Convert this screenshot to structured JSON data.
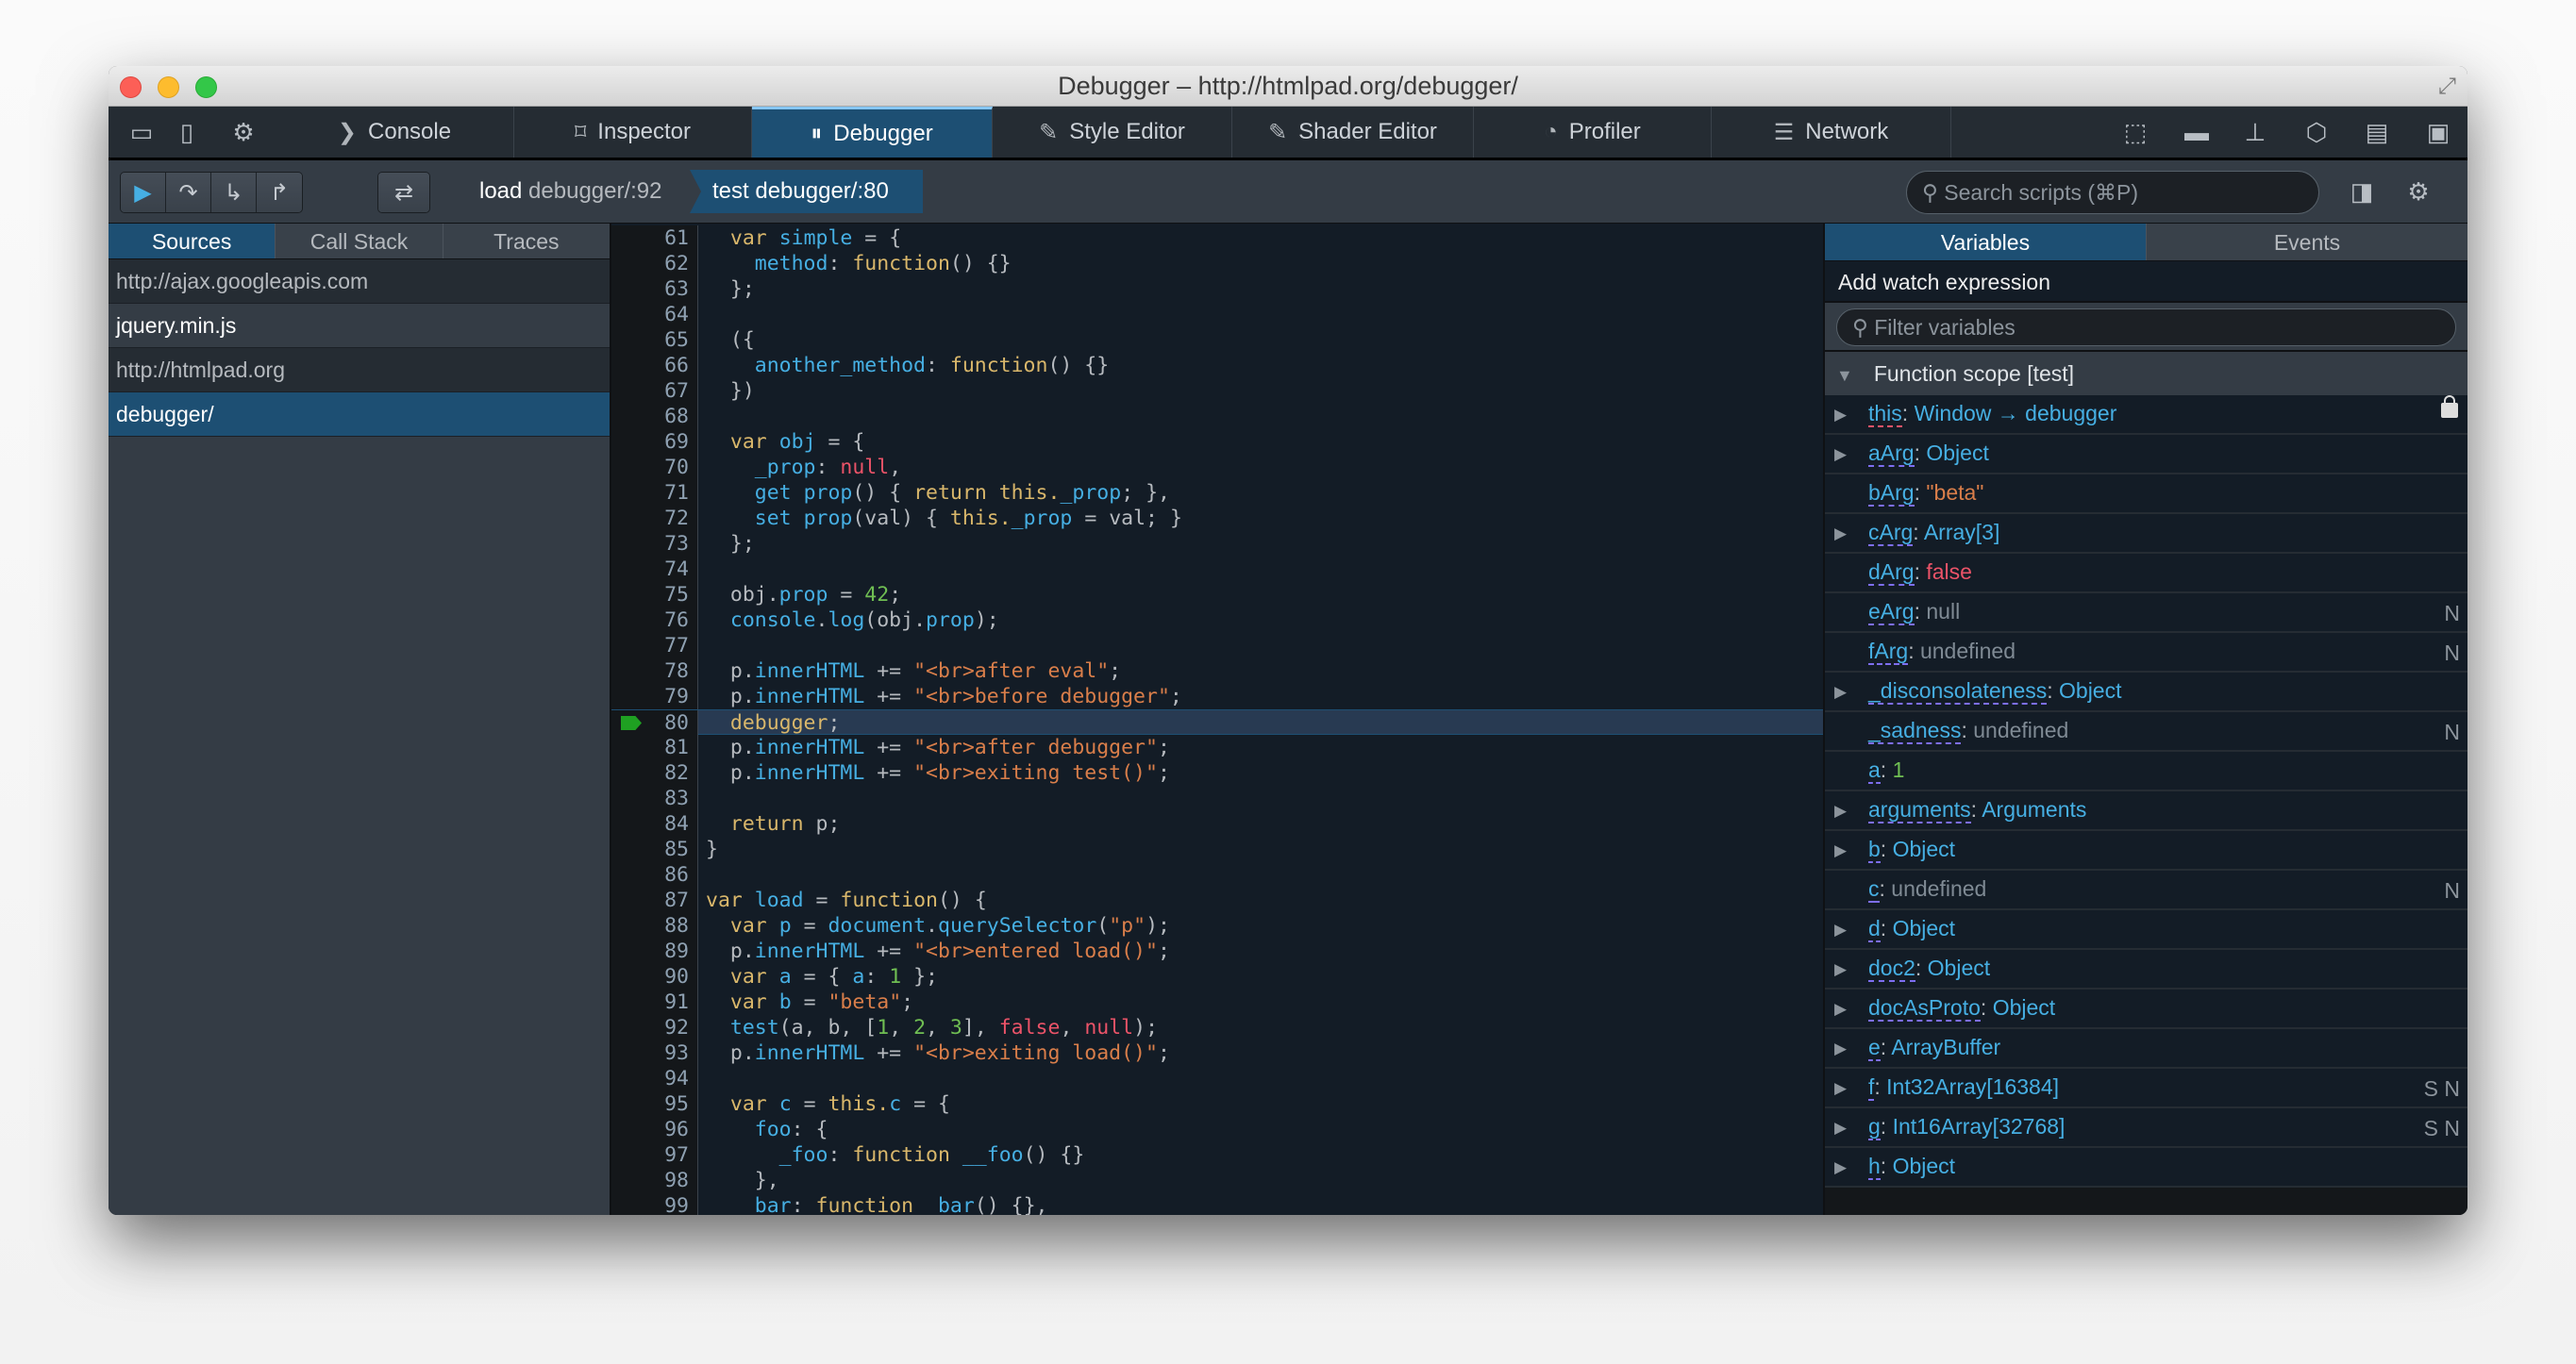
{
  "window": {
    "title": "Debugger – http://htmlpad.org/debugger/"
  },
  "toolbox": {
    "tabs": [
      {
        "label": "Console",
        "icon": "console-chevron-icon"
      },
      {
        "label": "Inspector",
        "icon": "inspector-icon"
      },
      {
        "label": "Debugger",
        "icon": "debugger-pause-icon",
        "active": true
      },
      {
        "label": "Style Editor",
        "icon": "style-editor-icon"
      },
      {
        "label": "Shader Editor",
        "icon": "shader-editor-icon"
      },
      {
        "label": "Profiler",
        "icon": "profiler-gauge-icon"
      },
      {
        "label": "Network",
        "icon": "network-icon"
      }
    ],
    "right_icons": [
      "pick-element-icon",
      "split-console-icon",
      "paintbrush-icon",
      "3d-view-icon",
      "scratchpad-icon",
      "responsive-mode-icon"
    ]
  },
  "debugger_toolbar": {
    "buttons": [
      "resume-icon",
      "step-over-icon",
      "step-in-icon",
      "step-out-icon"
    ],
    "toggle": "swap-icon",
    "stack": [
      {
        "fn": "load",
        "loc": "debugger/:92"
      },
      {
        "fn": "test",
        "loc": "debugger/:80",
        "active": true
      }
    ],
    "search_placeholder": "Search scripts (⌘P)"
  },
  "left_panel": {
    "tabs": [
      "Sources",
      "Call Stack",
      "Traces"
    ],
    "active_tab": "Sources",
    "sources": [
      {
        "label": "http://ajax.googleapis.com",
        "kind": "group"
      },
      {
        "label": "jquery.min.js",
        "kind": "file"
      },
      {
        "label": "http://htmlpad.org",
        "kind": "group"
      },
      {
        "label": "debugger/",
        "kind": "file",
        "selected": true
      }
    ],
    "bottom_buttons": [
      "eye-icon",
      "pretty-print-braces-icon",
      "blackbox-circle-icon"
    ],
    "pretty_print_label": "{}"
  },
  "editor": {
    "current_line": 80,
    "lines": [
      {
        "n": 61,
        "t": [
          [
            "  "
          ],
          [
            "var",
            "kw"
          ],
          [
            " "
          ],
          [
            "simple",
            "id"
          ],
          [
            " = {"
          ]
        ]
      },
      {
        "n": 62,
        "t": [
          [
            "    "
          ],
          [
            "method",
            "id"
          ],
          [
            ": "
          ],
          [
            "function",
            "kw"
          ],
          [
            "() {}"
          ]
        ]
      },
      {
        "n": 63,
        "t": [
          [
            "  };"
          ]
        ]
      },
      {
        "n": 64,
        "t": []
      },
      {
        "n": 65,
        "t": [
          [
            "  ({"
          ]
        ]
      },
      {
        "n": 66,
        "t": [
          [
            "    "
          ],
          [
            "another_method",
            "id"
          ],
          [
            ": "
          ],
          [
            "function",
            "kw"
          ],
          [
            "() {}"
          ]
        ]
      },
      {
        "n": 67,
        "t": [
          [
            "  })"
          ]
        ]
      },
      {
        "n": 68,
        "t": []
      },
      {
        "n": 69,
        "t": [
          [
            "  "
          ],
          [
            "var",
            "kw"
          ],
          [
            " "
          ],
          [
            "obj",
            "id"
          ],
          [
            " = {"
          ]
        ]
      },
      {
        "n": 70,
        "t": [
          [
            "    "
          ],
          [
            "_prop",
            "id"
          ],
          [
            ": "
          ],
          [
            "null",
            "red"
          ],
          [
            ","
          ]
        ]
      },
      {
        "n": 71,
        "t": [
          [
            "    "
          ],
          [
            "get",
            "id"
          ],
          [
            " "
          ],
          [
            "prop",
            "id"
          ],
          [
            "() { "
          ],
          [
            "return",
            "kw"
          ],
          [
            " "
          ],
          [
            "this.",
            "kw"
          ],
          [
            "_prop",
            "id"
          ],
          [
            "; },"
          ]
        ]
      },
      {
        "n": 72,
        "t": [
          [
            "    "
          ],
          [
            "set",
            "id"
          ],
          [
            " "
          ],
          [
            "prop",
            "id"
          ],
          [
            "(val) { "
          ],
          [
            "this.",
            "kw"
          ],
          [
            "_prop",
            "id"
          ],
          [
            " = val; }"
          ]
        ]
      },
      {
        "n": 73,
        "t": [
          [
            "  };"
          ]
        ]
      },
      {
        "n": 74,
        "t": []
      },
      {
        "n": 75,
        "t": [
          [
            "  obj."
          ],
          [
            "prop",
            "id"
          ],
          [
            " = "
          ],
          [
            "42",
            "num"
          ],
          [
            ";"
          ]
        ]
      },
      {
        "n": 76,
        "t": [
          [
            "  "
          ],
          [
            "console",
            "id"
          ],
          [
            "."
          ],
          [
            "log",
            "id"
          ],
          [
            "(obj."
          ],
          [
            "prop",
            "id"
          ],
          [
            ");"
          ]
        ]
      },
      {
        "n": 77,
        "t": []
      },
      {
        "n": 78,
        "t": [
          [
            "  p."
          ],
          [
            "innerHTML",
            "id"
          ],
          [
            " += "
          ],
          [
            "\"<br>after eval\"",
            "str"
          ],
          [
            ";"
          ]
        ]
      },
      {
        "n": 79,
        "t": [
          [
            "  p."
          ],
          [
            "innerHTML",
            "id"
          ],
          [
            " += "
          ],
          [
            "\"<br>before debugger\"",
            "str"
          ],
          [
            ";"
          ]
        ]
      },
      {
        "n": 80,
        "t": [
          [
            "  "
          ],
          [
            "debugger",
            "kw"
          ],
          [
            ";"
          ]
        ]
      },
      {
        "n": 81,
        "t": [
          [
            "  p."
          ],
          [
            "innerHTML",
            "id"
          ],
          [
            " += "
          ],
          [
            "\"<br>after debugger\"",
            "str"
          ],
          [
            ";"
          ]
        ]
      },
      {
        "n": 82,
        "t": [
          [
            "  p."
          ],
          [
            "innerHTML",
            "id"
          ],
          [
            " += "
          ],
          [
            "\"<br>exiting test()\"",
            "str"
          ],
          [
            ";"
          ]
        ]
      },
      {
        "n": 83,
        "t": []
      },
      {
        "n": 84,
        "t": [
          [
            "  "
          ],
          [
            "return",
            "kw"
          ],
          [
            " p;"
          ]
        ]
      },
      {
        "n": 85,
        "t": [
          [
            "}"
          ]
        ]
      },
      {
        "n": 86,
        "t": []
      },
      {
        "n": 87,
        "t": [
          [
            "var",
            "kw"
          ],
          [
            " "
          ],
          [
            "load",
            "id"
          ],
          [
            " = "
          ],
          [
            "function",
            "kw"
          ],
          [
            "() {"
          ]
        ]
      },
      {
        "n": 88,
        "t": [
          [
            "  "
          ],
          [
            "var",
            "kw"
          ],
          [
            " "
          ],
          [
            "p",
            "id"
          ],
          [
            " = "
          ],
          [
            "document",
            "id"
          ],
          [
            "."
          ],
          [
            "querySelector",
            "id"
          ],
          [
            "("
          ],
          [
            "\"p\"",
            "str"
          ],
          [
            ");"
          ]
        ]
      },
      {
        "n": 89,
        "t": [
          [
            "  p."
          ],
          [
            "innerHTML",
            "id"
          ],
          [
            " += "
          ],
          [
            "\"<br>entered load()\"",
            "str"
          ],
          [
            ";"
          ]
        ]
      },
      {
        "n": 90,
        "t": [
          [
            "  "
          ],
          [
            "var",
            "kw"
          ],
          [
            " "
          ],
          [
            "a",
            "id"
          ],
          [
            " = { "
          ],
          [
            "a",
            "id"
          ],
          [
            ": "
          ],
          [
            "1",
            "num"
          ],
          [
            " };"
          ]
        ]
      },
      {
        "n": 91,
        "t": [
          [
            "  "
          ],
          [
            "var",
            "kw"
          ],
          [
            " "
          ],
          [
            "b",
            "id"
          ],
          [
            " = "
          ],
          [
            "\"beta\"",
            "str"
          ],
          [
            ";"
          ]
        ]
      },
      {
        "n": 92,
        "t": [
          [
            "  "
          ],
          [
            "test",
            "id"
          ],
          [
            "(a, b, ["
          ],
          [
            "1",
            "num"
          ],
          [
            ", "
          ],
          [
            "2",
            "num"
          ],
          [
            ", "
          ],
          [
            "3",
            "num"
          ],
          [
            "], "
          ],
          [
            "false",
            "red"
          ],
          [
            ", "
          ],
          [
            "null",
            "red"
          ],
          [
            ");"
          ]
        ]
      },
      {
        "n": 93,
        "t": [
          [
            "  p."
          ],
          [
            "innerHTML",
            "id"
          ],
          [
            " += "
          ],
          [
            "\"<br>exiting load()\"",
            "str"
          ],
          [
            ";"
          ]
        ]
      },
      {
        "n": 94,
        "t": []
      },
      {
        "n": 95,
        "t": [
          [
            "  "
          ],
          [
            "var",
            "kw"
          ],
          [
            " "
          ],
          [
            "c",
            "id"
          ],
          [
            " = "
          ],
          [
            "this.",
            "kw"
          ],
          [
            "c",
            "id"
          ],
          [
            " = {"
          ]
        ]
      },
      {
        "n": 96,
        "t": [
          [
            "    "
          ],
          [
            "foo",
            "id"
          ],
          [
            ": {"
          ]
        ]
      },
      {
        "n": 97,
        "t": [
          [
            "      "
          ],
          [
            "_foo",
            "id"
          ],
          [
            ": "
          ],
          [
            "function",
            "kw"
          ],
          [
            " "
          ],
          [
            "__foo",
            "id"
          ],
          [
            "() {}"
          ]
        ]
      },
      {
        "n": 98,
        "t": [
          [
            "    },"
          ]
        ]
      },
      {
        "n": 99,
        "t": [
          [
            "    "
          ],
          [
            "bar",
            "id"
          ],
          [
            ": "
          ],
          [
            "function",
            "kw"
          ],
          [
            " "
          ],
          [
            "_bar",
            "id"
          ],
          [
            "() {},"
          ]
        ]
      }
    ]
  },
  "right_panel": {
    "tabs": [
      "Variables",
      "Events"
    ],
    "active_tab": "Variables",
    "add_watch_label": "Add watch expression",
    "filter_placeholder": "Filter variables",
    "scope_label": "Function scope [test]",
    "variables": [
      {
        "name": "this",
        "value": "Window → debugger",
        "type": "plain",
        "expandable": true,
        "locked": true
      },
      {
        "name": "aArg",
        "value": "Object",
        "type": "plain",
        "expandable": true
      },
      {
        "name": "bArg",
        "value": "\"beta\"",
        "type": "string"
      },
      {
        "name": "cArg",
        "value": "Array[3]",
        "type": "plain",
        "expandable": true
      },
      {
        "name": "dArg",
        "value": "false",
        "type": "red"
      },
      {
        "name": "eArg",
        "value": "null",
        "type": "gray",
        "flags": "N"
      },
      {
        "name": "fArg",
        "value": "undefined",
        "type": "gray",
        "flags": "N"
      },
      {
        "name": "_disconsolateness",
        "value": "Object",
        "type": "plain",
        "expandable": true
      },
      {
        "name": "_sadness",
        "value": "undefined",
        "type": "gray",
        "flags": "N"
      },
      {
        "name": "a",
        "value": "1",
        "type": "num"
      },
      {
        "name": "arguments",
        "value": "Arguments",
        "type": "plain",
        "expandable": true
      },
      {
        "name": "b",
        "value": "Object",
        "type": "plain",
        "expandable": true
      },
      {
        "name": "c",
        "value": "undefined",
        "type": "gray",
        "flags": "N"
      },
      {
        "name": "d",
        "value": "Object",
        "type": "plain",
        "expandable": true
      },
      {
        "name": "doc2",
        "value": "Object",
        "type": "plain",
        "expandable": true
      },
      {
        "name": "docAsProto",
        "value": "Object",
        "type": "plain",
        "expandable": true
      },
      {
        "name": "e",
        "value": "ArrayBuffer",
        "type": "plain",
        "expandable": true
      },
      {
        "name": "f",
        "value": "Int32Array[16384]",
        "type": "plain",
        "expandable": true,
        "flags": "S N"
      },
      {
        "name": "g",
        "value": "Int16Array[32768]",
        "type": "plain",
        "expandable": true,
        "flags": "S N"
      },
      {
        "name": "h",
        "value": "Object",
        "type": "plain",
        "expandable": true
      }
    ]
  },
  "colors": {
    "accent": "#1d4f73",
    "keyword": "#d9b76b",
    "identifier": "#46afe3",
    "string": "#d97e4a",
    "number": "#70bf53",
    "literal": "#eb5368",
    "breakpoint": "#1fa022"
  }
}
